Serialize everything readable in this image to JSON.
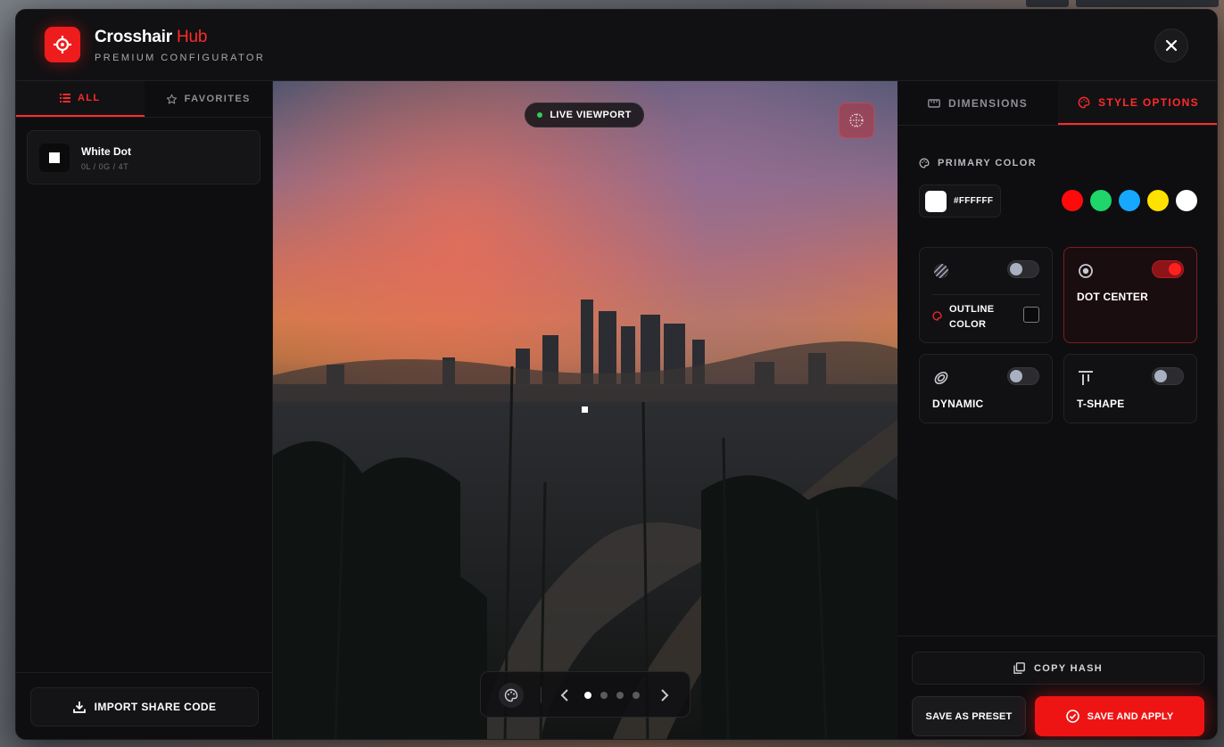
{
  "app": {
    "title_main": "Crosshair",
    "title_accent": "Hub",
    "subtitle": "PREMIUM CONFIGURATOR"
  },
  "left_tabs": [
    {
      "label": "ALL",
      "icon": "list-icon",
      "active": true
    },
    {
      "label": "FAVORITES",
      "icon": "star-icon",
      "active": false
    }
  ],
  "presets": [
    {
      "name": "White Dot",
      "meta": "0L / 0G / 4T"
    }
  ],
  "left_footer": {
    "import_label": "IMPORT SHARE CODE"
  },
  "viewport": {
    "live_label": "LIVE VIEWPORT",
    "page_count": 4,
    "current_page": 1
  },
  "right_tabs": [
    {
      "label": "DIMENSIONS",
      "icon": "ruler-icon",
      "active": false
    },
    {
      "label": "STYLE OPTIONS",
      "icon": "palette-icon",
      "active": true
    }
  ],
  "style": {
    "primary_color_label": "PRIMARY COLOR",
    "hex_value": "#FFFFFF",
    "swatches": [
      "#ff0a0a",
      "#1ed66a",
      "#16a8ff",
      "#ffe100",
      "#ffffff"
    ],
    "outline": {
      "enabled": false,
      "label_line1": "OUTLINE",
      "label_line2": "COLOR",
      "checked": false
    },
    "dot_center": {
      "label": "DOT CENTER",
      "enabled": true
    },
    "dynamic": {
      "label": "DYNAMIC",
      "enabled": false
    },
    "t_shape": {
      "label": "T-SHAPE",
      "enabled": false
    }
  },
  "actions": {
    "copy_hash": "COPY HASH",
    "save_preset": "SAVE AS PRESET",
    "save_apply": "SAVE AND APPLY"
  },
  "colors": {
    "accent": "#ff2a2a",
    "live": "#2ecc55"
  }
}
